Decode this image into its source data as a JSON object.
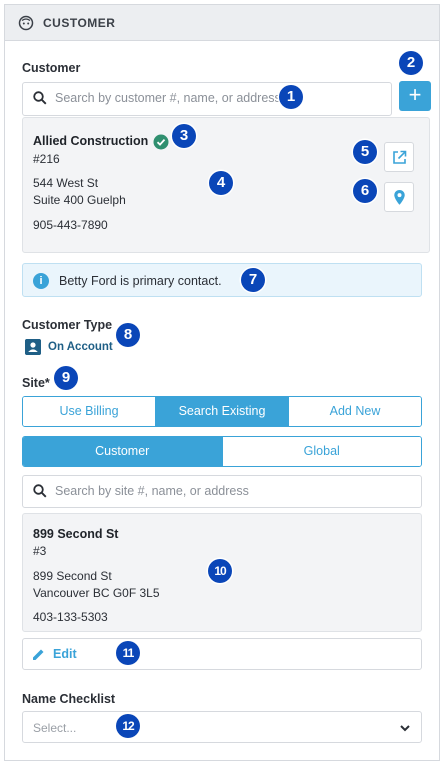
{
  "header": {
    "title": "CUSTOMER",
    "icon": "face-icon"
  },
  "customer": {
    "label": "Customer",
    "search_placeholder": "Search by customer #, name, or address",
    "add_label": "+",
    "card": {
      "name": "Allied Construction",
      "number": "#216",
      "address_line1": "544 West St",
      "address_line2": "Suite 400 Guelph",
      "phone": "905-443-7890"
    }
  },
  "info": {
    "text": "Betty Ford is primary contact."
  },
  "customer_type": {
    "label": "Customer Type",
    "value": "On Account"
  },
  "site": {
    "label": "Site*",
    "modes": [
      "Use Billing",
      "Search Existing",
      "Add New"
    ],
    "active_mode": "Search Existing",
    "scopes": [
      "Customer",
      "Global"
    ],
    "active_scope": "Customer",
    "search_placeholder": "Search by site #, name, or address",
    "card": {
      "name": "899 Second St",
      "number": "#3",
      "address_line1": "899 Second St",
      "address_line2": "Vancouver BC G0F 3L5",
      "phone": "403-133-5303"
    },
    "edit_label": "Edit"
  },
  "name_checklist": {
    "label": "Name Checklist",
    "placeholder": "Select..."
  },
  "badges": [
    "1",
    "2",
    "3",
    "4",
    "5",
    "6",
    "7",
    "8",
    "9",
    "10",
    "11",
    "12"
  ],
  "colors": {
    "accent": "#3aa3d8",
    "badge": "#0a46b8",
    "verified": "#2f8f6f",
    "header_bg": "#eceef1"
  }
}
